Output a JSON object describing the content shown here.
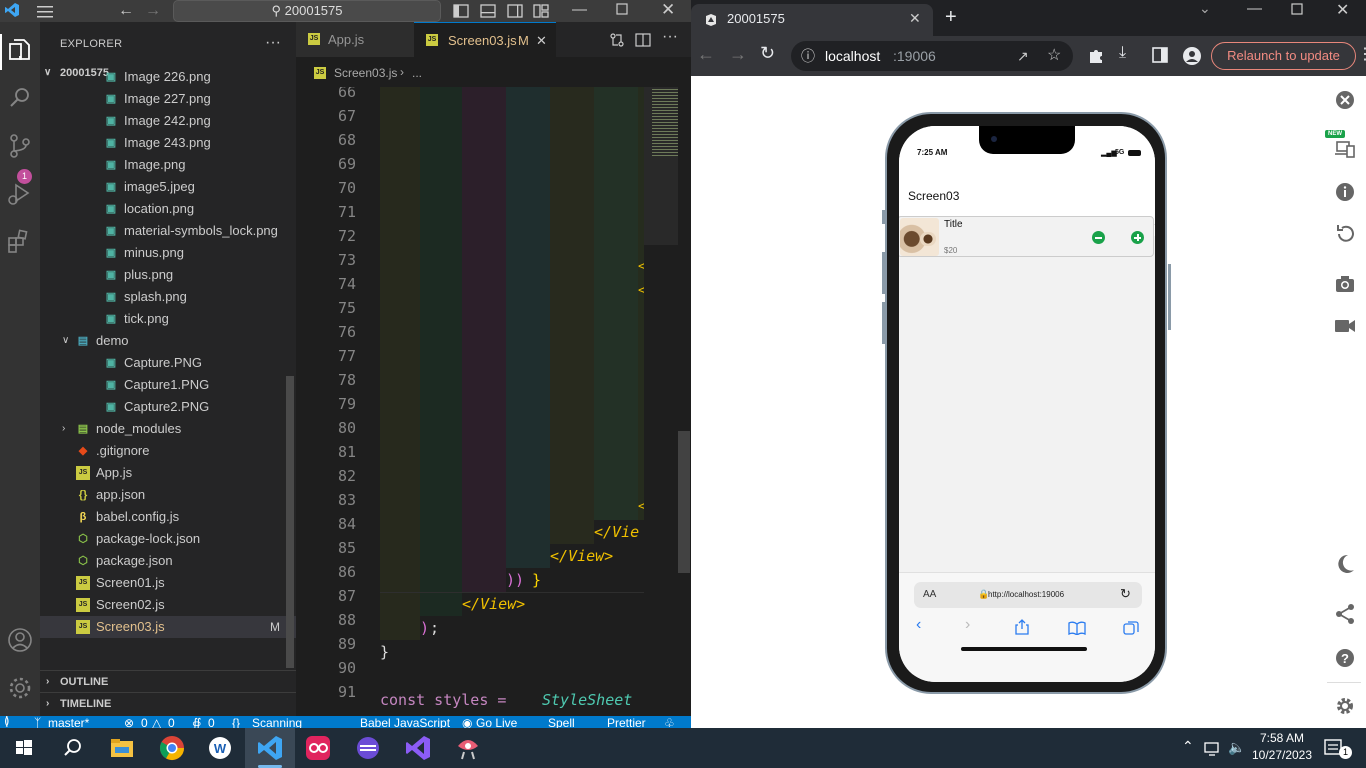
{
  "vscode": {
    "search_text": "20001575",
    "explorer_title": "EXPLORER",
    "folder_name": "20001575",
    "tree": [
      {
        "label": "Image 226.png",
        "type": "png",
        "indent": 1
      },
      {
        "label": "Image 227.png",
        "type": "png",
        "indent": 1
      },
      {
        "label": "Image 242.png",
        "type": "png",
        "indent": 1
      },
      {
        "label": "Image 243.png",
        "type": "png",
        "indent": 1
      },
      {
        "label": "Image.png",
        "type": "png",
        "indent": 1
      },
      {
        "label": "image5.jpeg",
        "type": "png",
        "indent": 1
      },
      {
        "label": "location.png",
        "type": "png",
        "indent": 1
      },
      {
        "label": "material-symbols_lock.png",
        "type": "png",
        "indent": 1
      },
      {
        "label": "minus.png",
        "type": "png",
        "indent": 1
      },
      {
        "label": "plus.png",
        "type": "png",
        "indent": 1
      },
      {
        "label": "splash.png",
        "type": "png",
        "indent": 1
      },
      {
        "label": "tick.png",
        "type": "png",
        "indent": 1
      },
      {
        "label": "demo",
        "type": "folder-open",
        "indent": 0
      },
      {
        "label": "Capture.PNG",
        "type": "png",
        "indent": 1
      },
      {
        "label": "Capture1.PNG",
        "type": "png",
        "indent": 1
      },
      {
        "label": "Capture2.PNG",
        "type": "png",
        "indent": 1
      },
      {
        "label": "node_modules",
        "type": "folder",
        "indent": 0
      },
      {
        "label": ".gitignore",
        "type": "git",
        "indent": 0
      },
      {
        "label": "App.js",
        "type": "js",
        "indent": 0
      },
      {
        "label": "app.json",
        "type": "json",
        "indent": 0
      },
      {
        "label": "babel.config.js",
        "type": "babel",
        "indent": 0
      },
      {
        "label": "package-lock.json",
        "type": "node",
        "indent": 0
      },
      {
        "label": "package.json",
        "type": "node",
        "indent": 0
      },
      {
        "label": "Screen01.js",
        "type": "js",
        "indent": 0
      },
      {
        "label": "Screen02.js",
        "type": "js",
        "indent": 0
      },
      {
        "label": "Screen03.js",
        "type": "js",
        "indent": 0,
        "selected": true,
        "badge": "M"
      }
    ],
    "outline_label": "OUTLINE",
    "timeline_label": "TIMELINE",
    "tabs": [
      {
        "label": "App.js",
        "active": false
      },
      {
        "label": "Screen03.js",
        "active": true,
        "badge": "M"
      }
    ],
    "breadcrumb": [
      "Screen03.js",
      "..."
    ],
    "line_numbers": [
      "66",
      "67",
      "68",
      "69",
      "70",
      "71",
      "72",
      "73",
      "74",
      "75",
      "76",
      "77",
      "78",
      "79",
      "80",
      "81",
      "82",
      "83",
      "84",
      "85",
      "86",
      "87",
      "88",
      "89",
      "90",
      "91"
    ],
    "code_lines": {
      "l84": "</Vie",
      "l85": "</View>",
      "l86a": "))",
      "l86b": "}",
      "l87": "</View>",
      "l88a": ")",
      "l88b": ";",
      "l89": "}",
      "l91a": "const styles = ",
      "l91b": "StyleSheet"
    },
    "status": {
      "branch": "master*",
      "errors": "0",
      "warnings": "0",
      "ports": "0",
      "scanning": "Scanning",
      "language": "Babel JavaScript",
      "golive": "Go Live",
      "spell": "Spell",
      "prettier": "Prettier"
    }
  },
  "chrome": {
    "tab_title": "20001575",
    "url_host": "localhost",
    "url_port": ":19006",
    "relaunch_label": "Relaunch to update",
    "new_badge": "NEW"
  },
  "phone": {
    "time": "7:25 AM",
    "network": "5G",
    "header_title": "Screen03",
    "item": {
      "title": "Title",
      "price": "$20"
    },
    "address": "http://localhost:19006",
    "aa_label": "AA"
  },
  "taskbar": {
    "time": "7:58 AM",
    "date": "10/27/2023",
    "notifications": "1"
  },
  "colors": {
    "vscode_accent": "#007acc",
    "plus_minus_green": "#1aa24a",
    "relaunch": "#f28b82"
  }
}
